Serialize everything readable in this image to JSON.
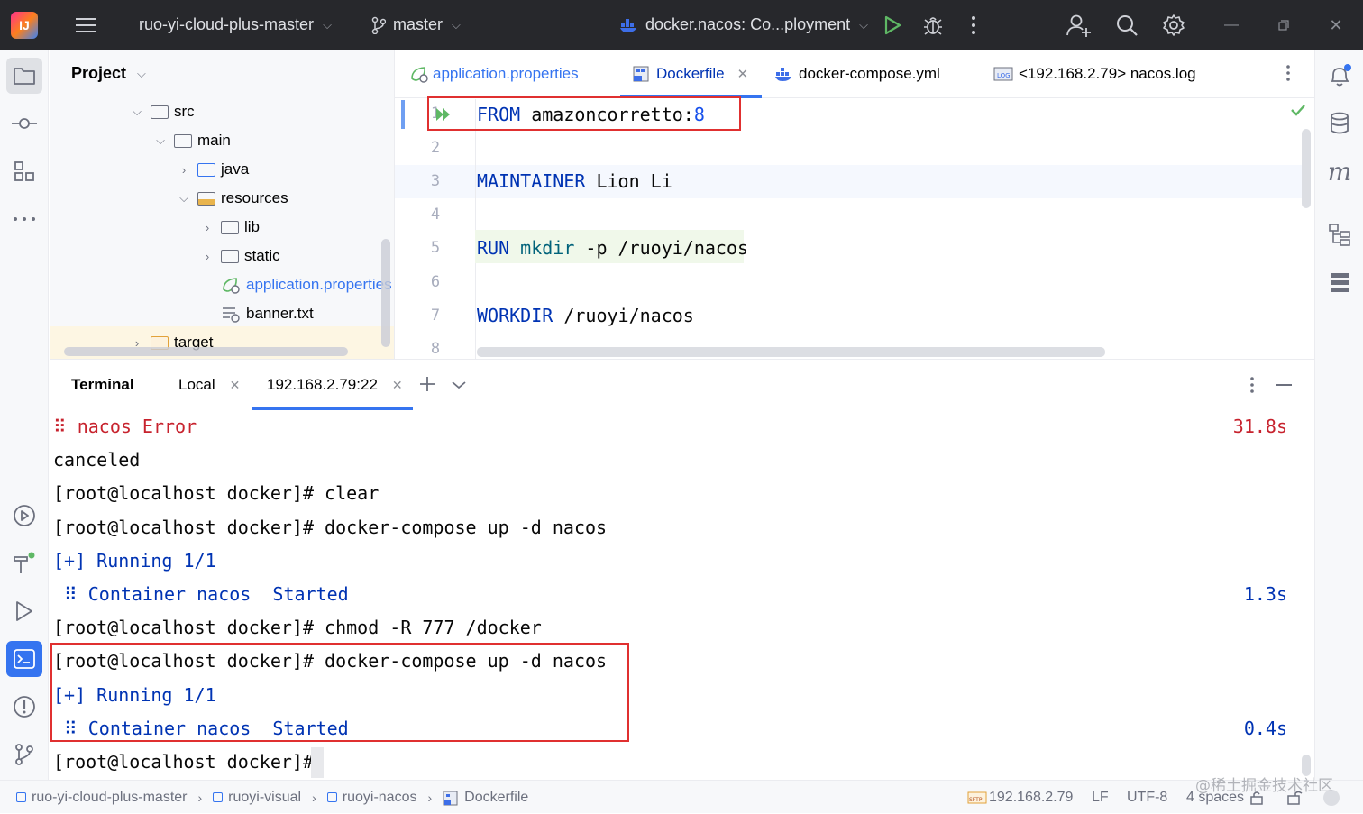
{
  "titlebar": {
    "project": "ruo-yi-cloud-plus-master",
    "branch": "master",
    "run_config": "docker.nacos: Co...ployment"
  },
  "project_panel": {
    "title": "Project",
    "tree": [
      {
        "label": "src",
        "type": "folder"
      },
      {
        "label": "main",
        "type": "folder"
      },
      {
        "label": "java",
        "type": "folder-blue"
      },
      {
        "label": "resources",
        "type": "folder-res"
      },
      {
        "label": "lib",
        "type": "folder"
      },
      {
        "label": "static",
        "type": "folder"
      },
      {
        "label": "application.properties",
        "type": "file-props"
      },
      {
        "label": "banner.txt",
        "type": "file-txt"
      },
      {
        "label": "target",
        "type": "folder-orange"
      }
    ]
  },
  "editor": {
    "tabs": [
      {
        "label": "application.properties"
      },
      {
        "label": "Dockerfile",
        "active": true
      },
      {
        "label": "docker-compose.yml"
      },
      {
        "label": "<192.168.2.79> nacos.log"
      }
    ],
    "line_numbers": [
      "1",
      "2",
      "3",
      "4",
      "5",
      "6",
      "7",
      "8"
    ],
    "lines": {
      "l1": {
        "kw": "FROM",
        "text": " amazoncorretto:",
        "num": "8"
      },
      "l3": {
        "kw": "MAINTAINER",
        "text": " Lion Li"
      },
      "l5": {
        "kw": "RUN",
        "fn": "mkdir",
        "text": " -p /ruoyi/nacos"
      },
      "l7": {
        "kw": "WORKDIR",
        "text": " /ruoyi/nacos"
      }
    }
  },
  "terminal": {
    "title": "Terminal",
    "tabs": [
      {
        "label": "Local"
      },
      {
        "label": "192.168.2.79:22",
        "active": true
      }
    ],
    "lines": [
      {
        "text": "⠿ nacos Error",
        "right": "31.8s"
      },
      {
        "text": "canceled"
      },
      {
        "text": "[root@localhost docker]# clear"
      },
      {
        "text": "[root@localhost docker]# docker-compose up -d nacos"
      },
      {
        "text": "[+] Running 1/1"
      },
      {
        "text": " ⠿ Container nacos  Started",
        "right": "1.3s"
      },
      {
        "text": "[root@localhost docker]# chmod -R 777 /docker"
      },
      {
        "text": "[root@localhost docker]# docker-compose up -d nacos"
      },
      {
        "text": "[+] Running 1/1"
      },
      {
        "text": " ⠿ Container nacos  Started",
        "right": "0.4s"
      },
      {
        "text": "[root@localhost docker]#"
      }
    ]
  },
  "statusbar": {
    "breadcrumb": [
      "ruo-yi-cloud-plus-master",
      "ruoyi-visual",
      "ruoyi-nacos",
      "Dockerfile"
    ],
    "host": "192.168.2.79",
    "line_sep": "LF",
    "encoding": "UTF-8",
    "indent": "4 spaces",
    "watermark": "@稀土掘金技术社区"
  }
}
